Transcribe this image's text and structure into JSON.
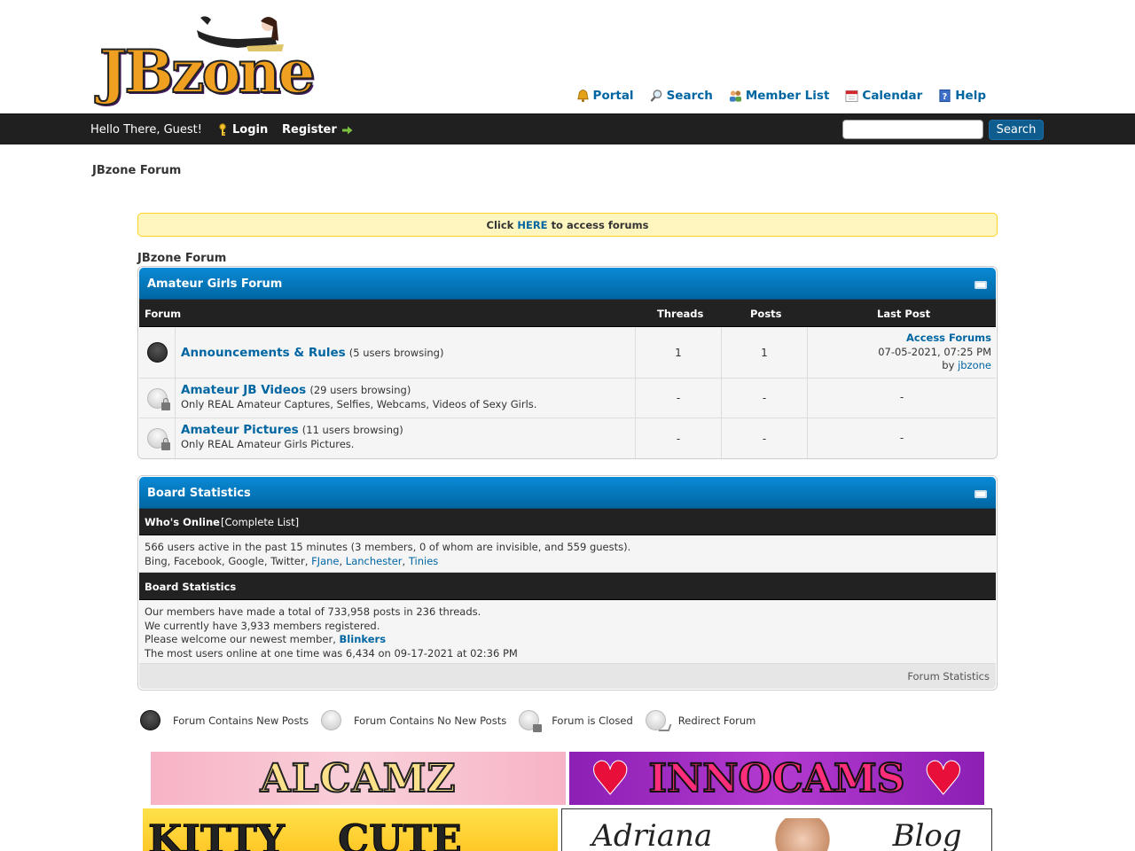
{
  "header": {
    "logo_text": "JBzone",
    "toplinks": [
      {
        "label": "Portal",
        "icon": "bell-icon"
      },
      {
        "label": "Search",
        "icon": "magnifier-icon"
      },
      {
        "label": "Member List",
        "icon": "members-icon"
      },
      {
        "label": "Calendar",
        "icon": "calendar-icon"
      },
      {
        "label": "Help",
        "icon": "help-icon"
      }
    ]
  },
  "navbar": {
    "greeting": "Hello There, Guest!",
    "login_label": "Login",
    "register_label": "Register",
    "search_value": "",
    "search_button": "Search"
  },
  "breadcrumb": "JBzone Forum",
  "notice": {
    "prefix": "Click",
    "link": "HERE",
    "suffix": "to access forums"
  },
  "forum_section_label": "JBzone Forum",
  "forum_table": {
    "title": "Amateur Girls Forum",
    "columns": {
      "forum": "Forum",
      "threads": "Threads",
      "posts": "Posts",
      "last_post": "Last Post"
    },
    "rows": [
      {
        "name": "Announcements & Rules",
        "browsing": "(5 users browsing)",
        "description": "",
        "status": "new",
        "threads": "1",
        "posts": "1",
        "last_post": {
          "title": "Access Forums",
          "date": "07-05-2021, 07:25 PM",
          "by": "by",
          "user": "jbzone"
        }
      },
      {
        "name": "Amateur JB Videos",
        "browsing": "(29 users browsing)",
        "description": "Only REAL Amateur Captures, Selfies, Webcams, Videos of Sexy Girls.",
        "status": "closed",
        "threads": "-",
        "posts": "-",
        "last_post_dash": "-"
      },
      {
        "name": "Amateur Pictures",
        "browsing": "(11 users browsing)",
        "description": "Only REAL Amateur Girls Pictures.",
        "status": "closed",
        "threads": "-",
        "posts": "-",
        "last_post_dash": "-"
      }
    ]
  },
  "stats": {
    "title": "Board Statistics",
    "whos_online_label": "Who's Online",
    "complete_list": "[Complete List]",
    "online_line": "566 users active in the past 15 minutes (3 members, 0 of whom are invisible, and 559 guests).",
    "bots": "Bing, Facebook, Google, Twitter,",
    "online_members": [
      "FJane",
      "Lanchester",
      "Tinies"
    ],
    "board_stats_label": "Board Statistics",
    "line1": "Our members have made a total of 733,958 posts in 236 threads.",
    "line2": "We currently have 3,933 members registered.",
    "line3_prefix": "Please welcome our newest member,",
    "newest_member": "Blinkers",
    "line4": "The most users online at one time was 6,434 on 09-17-2021 at 02:36 PM",
    "footer_link": "Forum Statistics"
  },
  "legend": [
    {
      "label": "Forum Contains New Posts",
      "type": "new"
    },
    {
      "label": "Forum Contains No New Posts",
      "type": "nonew"
    },
    {
      "label": "Forum is Closed",
      "type": "closed"
    },
    {
      "label": "Redirect Forum",
      "type": "redir"
    }
  ],
  "banners": {
    "alcamz": "ALCAMZ",
    "innocams": "INNOCAMS",
    "kitty_left": "KITTY",
    "kitty_right": "CUTE",
    "adriana_left": "Adriana",
    "adriana_right": "Blog"
  }
}
